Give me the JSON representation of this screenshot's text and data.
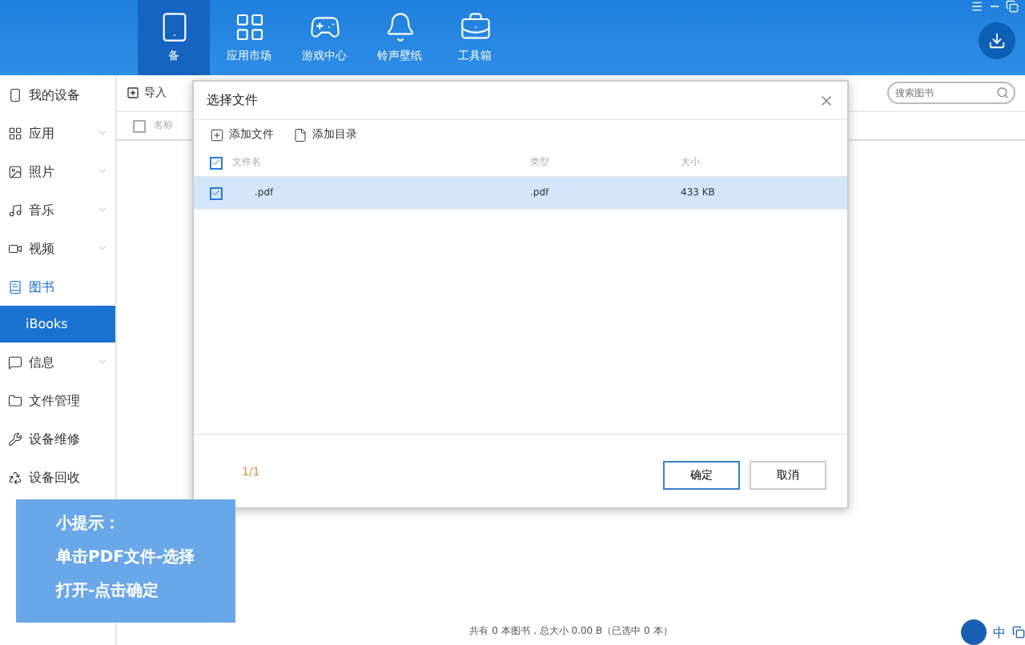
{
  "nav": [
    {
      "label": "备",
      "kind": "phone",
      "selected": true
    },
    {
      "label": "应用市场",
      "kind": "apps",
      "selected": false
    },
    {
      "label": "游戏中心",
      "kind": "game",
      "selected": false
    },
    {
      "label": "铃声壁纸",
      "kind": "bell",
      "selected": false
    },
    {
      "label": "工具箱",
      "kind": "toolbox",
      "selected": false
    }
  ],
  "sidebar": [
    {
      "label": "我的设备",
      "kind": "device",
      "chevron": false,
      "selected": false
    },
    {
      "label": "应用",
      "kind": "apps",
      "chevron": true,
      "selected": false
    },
    {
      "label": "照片",
      "kind": "photo",
      "chevron": true,
      "selected": false
    },
    {
      "label": "音乐",
      "kind": "music",
      "chevron": true,
      "selected": false
    },
    {
      "label": "视频",
      "kind": "video",
      "chevron": true,
      "selected": false
    },
    {
      "label": "图书",
      "kind": "book",
      "chevron": false,
      "selected": true,
      "children": [
        {
          "label": "iBooks",
          "selected": true
        }
      ]
    },
    {
      "label": "信息",
      "kind": "message",
      "chevron": true,
      "selected": false
    },
    {
      "label": "文件管理",
      "kind": "folder",
      "chevron": false,
      "selected": false
    },
    {
      "label": "设备维修",
      "kind": "repair",
      "chevron": false,
      "selected": false
    },
    {
      "label": "设备回收",
      "kind": "recycle",
      "chevron": false,
      "selected": false
    }
  ],
  "toolbar": {
    "import": "导入",
    "search": {
      "placeholder": "搜索图书"
    }
  },
  "table": {
    "columns": [
      "名称"
    ],
    "all_checked": false
  },
  "dialog": {
    "title": "选择文件",
    "actions": [
      "添加文件",
      "添加目录"
    ],
    "columns": [
      "文件名",
      "类型",
      "大小"
    ],
    "all_checked": true,
    "rows": [
      {
        "name": ".pdf",
        "type": ".pdf",
        "size": "433 KB",
        "checked": true,
        "selected": true
      }
    ],
    "count": "1/1",
    "buttons": [
      {
        "label": "确定",
        "focused": true
      },
      {
        "label": "取消",
        "focused": false
      }
    ]
  },
  "status_bar": "共有 0 本图书，总大小 0.00 B（已选中 0 本）",
  "tip": [
    "小提示：",
    "单击PDF文件-选择",
    "打开-点击确定"
  ],
  "ime": "中"
}
